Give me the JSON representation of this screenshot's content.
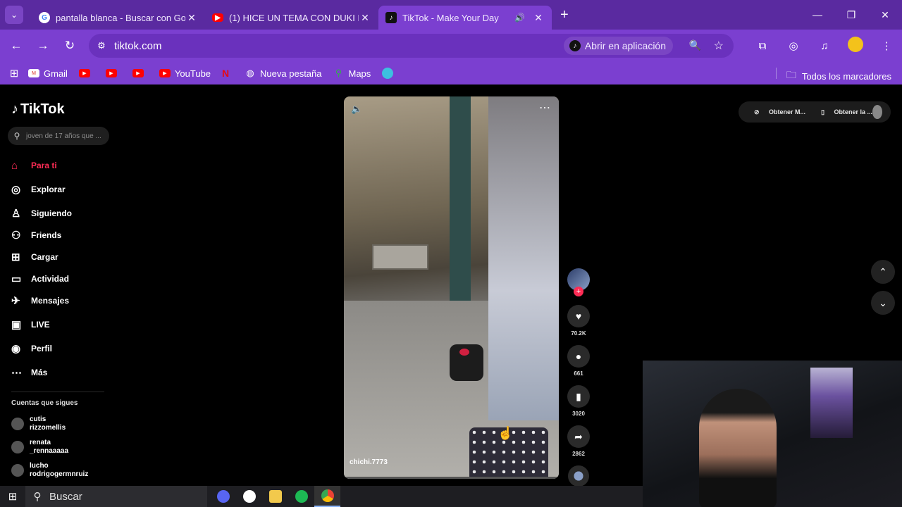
{
  "browser": {
    "tabs": [
      {
        "title": "pantalla blanca - Buscar con Google",
        "favicon": "google-icon",
        "close": "✕"
      },
      {
        "title": "(1) HICE UN TEMA CON DUKI EN",
        "favicon": "youtube-icon",
        "close": "✕"
      },
      {
        "title": "TikTok - Make Your Day",
        "favicon": "tiktok-icon",
        "close": "✕",
        "audio": "speaker-icon"
      }
    ],
    "new_tab": "+",
    "url": "tiktok.com",
    "open_in_app": "Abrir en aplicación",
    "bookmarks": [
      {
        "label": "Gmail",
        "icon": "gmail-icon"
      },
      {
        "label": "",
        "icon": "youtube-icon"
      },
      {
        "label": "",
        "icon": "youtube-icon"
      },
      {
        "label": "",
        "icon": "youtube-icon"
      },
      {
        "label": "YouTube",
        "icon": "youtube-icon"
      },
      {
        "label": "",
        "icon": "netflix-icon"
      },
      {
        "label": "Nueva pestaña",
        "icon": "globe-icon"
      },
      {
        "label": "Maps",
        "icon": "maps-icon"
      },
      {
        "label": "",
        "icon": "edge-icon"
      }
    ],
    "all_bookmarks": "Todos los marcadores"
  },
  "tiktok": {
    "logo": "TikTok",
    "search_placeholder": "joven de 17 años que ...",
    "nav": [
      {
        "label": "Para ti",
        "icon": "home-icon",
        "active": true
      },
      {
        "label": "Explorar",
        "icon": "compass-icon"
      },
      {
        "label": "Siguiendo",
        "icon": "following-icon"
      },
      {
        "label": "Friends",
        "icon": "friends-icon"
      },
      {
        "label": "Cargar",
        "icon": "upload-icon"
      },
      {
        "label": "Actividad",
        "icon": "activity-icon"
      },
      {
        "label": "Mensajes",
        "icon": "messages-icon"
      },
      {
        "label": "LIVE",
        "icon": "live-icon"
      },
      {
        "label": "Perfil",
        "icon": "profile-icon"
      },
      {
        "label": "Más",
        "icon": "more-icon"
      }
    ],
    "following_title": "Cuentas que sigues",
    "following": [
      {
        "name": "cutis",
        "handle": "rizzomellis"
      },
      {
        "name": "renata",
        "handle": "_rennaaaaa"
      },
      {
        "name": "lucho",
        "handle": "rodrigogermnruiz"
      }
    ],
    "video": {
      "author": "chichi.7773",
      "likes": "70.2K",
      "comments": "661",
      "saves": "3020",
      "shares": "2862"
    },
    "top_right": {
      "get_coins": "Obtener M...",
      "get_app": "Obtener la ..."
    }
  },
  "taskbar": {
    "search_label": "Buscar",
    "apps": [
      "discord-icon",
      "clock-icon",
      "files-icon",
      "spotify-icon",
      "chrome-icon"
    ]
  },
  "colors": {
    "chrome_purple": "#7b3fd0",
    "tiktok_red": "#fe2c55"
  }
}
